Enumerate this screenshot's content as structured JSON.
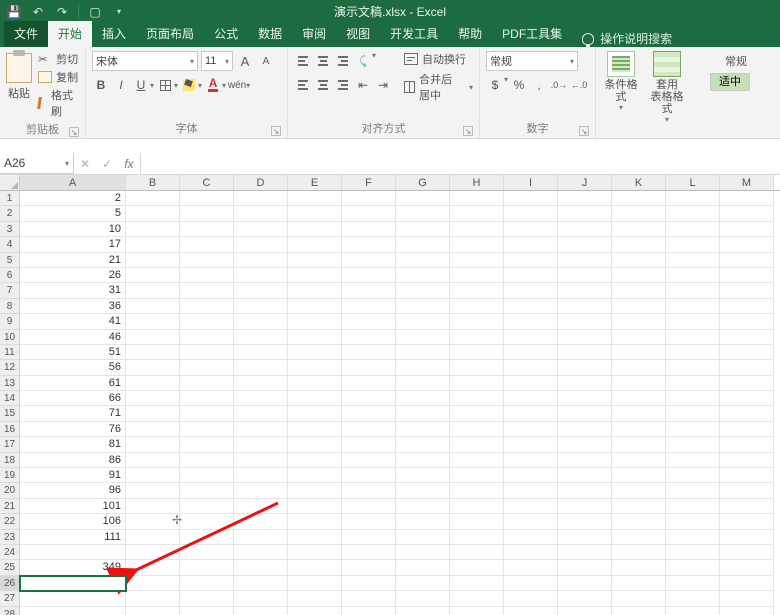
{
  "titlebar": {
    "title_left": "演示文稿.xlsx",
    "title_sep": " - ",
    "title_right": "Excel"
  },
  "tabs": {
    "file": "文件",
    "home": "开始",
    "insert": "插入",
    "layout": "页面布局",
    "formulas": "公式",
    "data": "数据",
    "review": "审阅",
    "view": "视图",
    "developer": "开发工具",
    "help": "帮助",
    "pdf": "PDF工具集",
    "tell_me": "操作说明搜索"
  },
  "ribbon": {
    "clipboard": {
      "paste": "粘贴",
      "cut": "剪切",
      "copy": "复制",
      "format_painter": "格式刷",
      "label": "剪贴板"
    },
    "font": {
      "name": "宋体",
      "size": "11",
      "label": "字体"
    },
    "alignment": {
      "wrap": "自动换行",
      "merge": "合并后居中",
      "label": "对齐方式"
    },
    "number": {
      "format": "常规",
      "label": "数字"
    },
    "styles": {
      "cond_fmt_1": "条件格式",
      "table_fmt_1": "套用",
      "table_fmt_2": "表格格式",
      "cell_styles_hdr": "常规",
      "cell_styles_sw": "适中"
    }
  },
  "fx": {
    "namebox": "A26",
    "fx_label": "fx"
  },
  "grid": {
    "cols": [
      "A",
      "B",
      "C",
      "D",
      "E",
      "F",
      "G",
      "H",
      "I",
      "J",
      "K",
      "L",
      "M"
    ],
    "rows": [
      1,
      2,
      3,
      4,
      5,
      6,
      7,
      8,
      9,
      10,
      11,
      12,
      13,
      14,
      15,
      16,
      17,
      18,
      19,
      20,
      21,
      22,
      23,
      24,
      25,
      26,
      27,
      28
    ],
    "colA": {
      "1": 2,
      "2": 5,
      "3": 10,
      "4": 17,
      "5": 21,
      "6": 26,
      "7": 31,
      "8": 36,
      "9": 41,
      "10": 46,
      "11": 51,
      "12": 56,
      "13": 61,
      "14": 66,
      "15": 71,
      "16": 76,
      "17": 81,
      "18": 86,
      "19": 91,
      "20": 96,
      "21": 101,
      "22": 106,
      "23": 111,
      "24": "",
      "25": 349
    },
    "selected_row": 26
  }
}
